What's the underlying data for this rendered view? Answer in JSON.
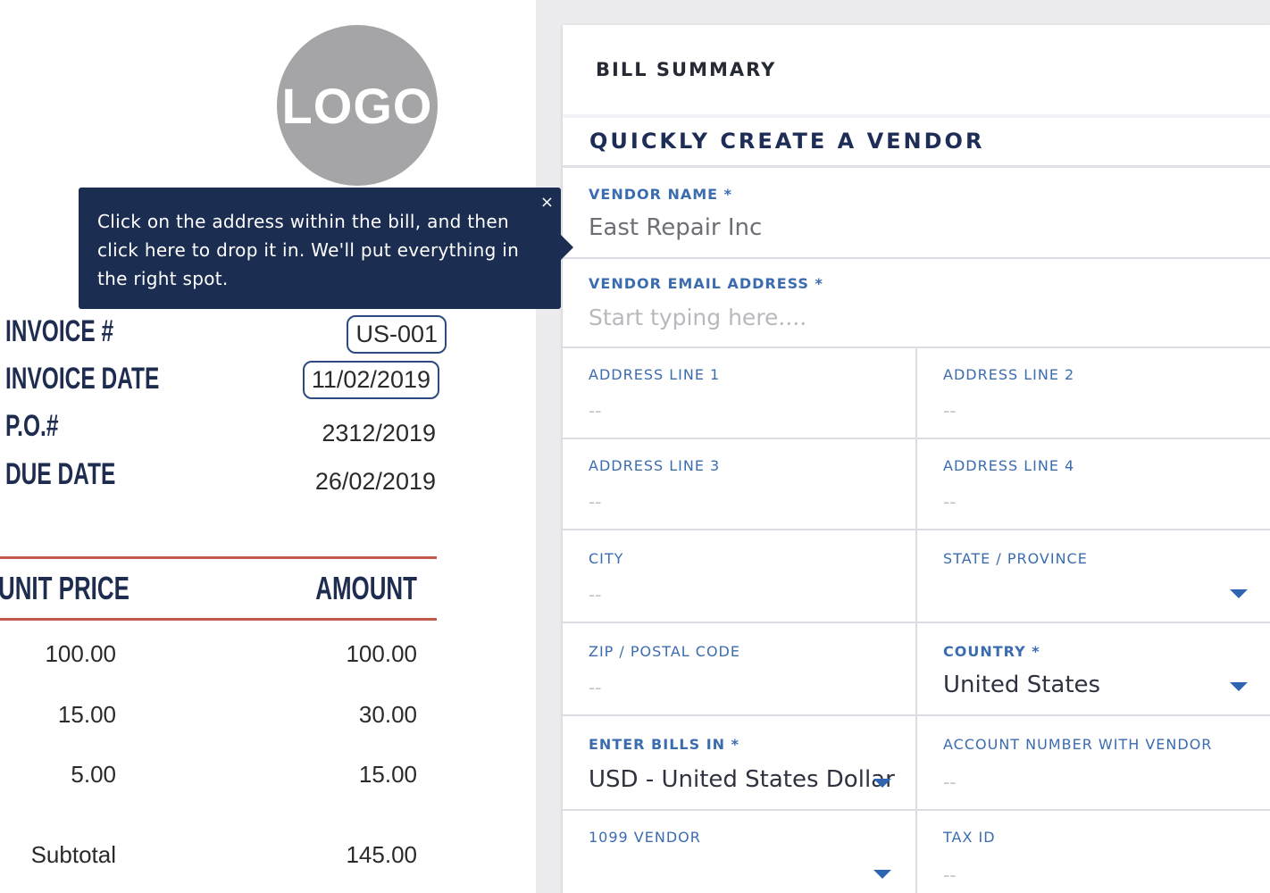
{
  "invoice": {
    "logo_text": "LOGO",
    "fields": [
      {
        "label": "INVOICE #",
        "value": "US-001"
      },
      {
        "label": "INVOICE DATE",
        "value": "11/02/2019"
      },
      {
        "label": "P.O.#",
        "value": "2312/2019"
      },
      {
        "label": "DUE DATE",
        "value": "26/02/2019"
      }
    ],
    "table": {
      "headers": [
        "UNIT PRICE",
        "AMOUNT"
      ],
      "rows": [
        [
          "100.00",
          "100.00"
        ],
        [
          "15.00",
          "30.00"
        ],
        [
          "5.00",
          "15.00"
        ]
      ],
      "subtotal_label": "Subtotal",
      "subtotal_value": "145.00"
    }
  },
  "tooltip": {
    "line1": "Click on the address within the bill, and then",
    "line2": "click here to drop it in. We'll put everything in",
    "line3": "the right spot.",
    "close": "×"
  },
  "panel": {
    "title": "BILL SUMMARY",
    "form_title": "QUICKLY CREATE A VENDOR",
    "vendor_name": {
      "label": "VENDOR NAME *",
      "value": "East Repair Inc"
    },
    "vendor_email": {
      "label": "VENDOR EMAIL ADDRESS *",
      "placeholder": "Start typing here...."
    },
    "address1": {
      "label": "ADDRESS LINE 1",
      "value": "--"
    },
    "address2": {
      "label": "ADDRESS LINE 2",
      "value": "--"
    },
    "address3": {
      "label": "ADDRESS LINE 3",
      "value": "--"
    },
    "address4": {
      "label": "ADDRESS LINE 4",
      "value": "--"
    },
    "city": {
      "label": "CITY",
      "value": "--"
    },
    "state": {
      "label": "STATE / PROVINCE",
      "value": ""
    },
    "zip": {
      "label": "ZIP / POSTAL CODE",
      "value": "--"
    },
    "country": {
      "label": "COUNTRY *",
      "value": "United States"
    },
    "currency": {
      "label": "ENTER BILLS IN *",
      "value": "USD - United States Dollar"
    },
    "account_number": {
      "label": "ACCOUNT NUMBER WITH VENDOR",
      "value": "--"
    },
    "vendor_1099": {
      "label": "1099 VENDOR",
      "value": ""
    },
    "tax_id": {
      "label": "TAX ID",
      "value": "--"
    }
  },
  "colors": {
    "tooltip_bg": "#1c2d52",
    "label_blue": "#3b6cb0",
    "heading_navy": "#1d2d55",
    "invoice_rule": "#c4584c"
  }
}
